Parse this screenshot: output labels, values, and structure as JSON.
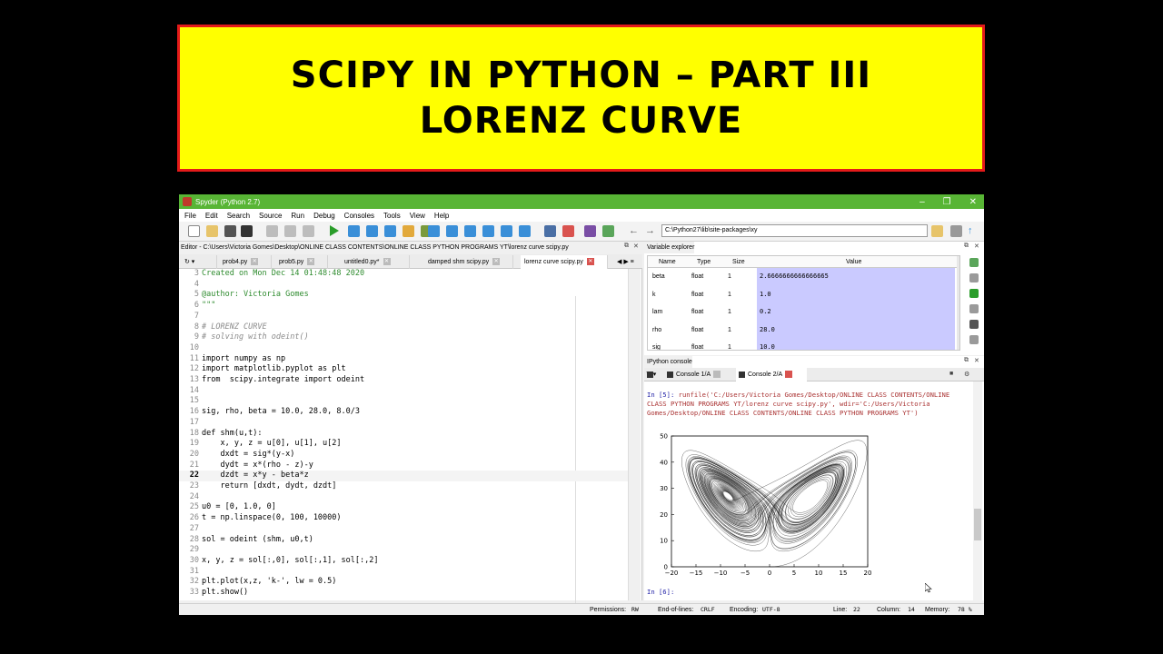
{
  "banner": {
    "line1": "SCIPY IN PYTHON – PART III",
    "line2": "LORENZ CURVE"
  },
  "window": {
    "title": "Spyder (Python 2.7)",
    "controls": [
      "–",
      "❐",
      "✕"
    ]
  },
  "menu": [
    "File",
    "Edit",
    "Search",
    "Source",
    "Run",
    "Debug",
    "Consoles",
    "Tools",
    "View",
    "Help"
  ],
  "toolbar": {
    "path": "C:\\Python27\\lib\\site-packages\\xy"
  },
  "editor": {
    "header": "Editor - C:\\Users\\Victoria Gomes\\Desktop\\ONLINE CLASS CONTENTS\\ONLINE CLASS PYTHON PROGRAMS YT\\lorenz curve scipy.py",
    "tabs": [
      "prob4.py",
      "prob5.py",
      "untitled0.py*",
      "damped shm scipy.py",
      "lorenz curve scipy.py"
    ],
    "lines": [
      {
        "n": "3",
        "t": "Created on Mon Dec 14 01:48:48 2020",
        "k": "str"
      },
      {
        "n": "4",
        "t": "",
        "k": ""
      },
      {
        "n": "5",
        "t": "@author: Victoria Gomes",
        "k": "str"
      },
      {
        "n": "6",
        "t": "\"\"\"",
        "k": "str"
      },
      {
        "n": "7",
        "t": "",
        "k": ""
      },
      {
        "n": "8",
        "t": "# LORENZ CURVE",
        "k": "cm"
      },
      {
        "n": "9",
        "t": "# solving with odeint()",
        "k": "cm"
      },
      {
        "n": "10",
        "t": "",
        "k": ""
      },
      {
        "n": "11",
        "t": "import numpy as np",
        "k": ""
      },
      {
        "n": "12",
        "t": "import matplotlib.pyplot as plt",
        "k": ""
      },
      {
        "n": "13",
        "t": "from  scipy.integrate import odeint",
        "k": ""
      },
      {
        "n": "14",
        "t": "",
        "k": ""
      },
      {
        "n": "15",
        "t": "",
        "k": ""
      },
      {
        "n": "16",
        "t": "sig, rho, beta = 10.0, 28.0, 8.0/3",
        "k": ""
      },
      {
        "n": "17",
        "t": "",
        "k": ""
      },
      {
        "n": "18",
        "t": "def shm(u,t):",
        "k": ""
      },
      {
        "n": "19",
        "t": "    x, y, z = u[0], u[1], u[2]",
        "k": ""
      },
      {
        "n": "20",
        "t": "    dxdt = sig*(y-x)",
        "k": ""
      },
      {
        "n": "21",
        "t": "    dydt = x*(rho - z)-y",
        "k": ""
      },
      {
        "n": "22",
        "t": "    dzdt = x*y - beta*z",
        "k": "cur"
      },
      {
        "n": "23",
        "t": "    return [dxdt, dydt, dzdt]",
        "k": ""
      },
      {
        "n": "24",
        "t": "",
        "k": ""
      },
      {
        "n": "25",
        "t": "u0 = [0, 1.0, 0]",
        "k": ""
      },
      {
        "n": "26",
        "t": "t = np.linspace(0, 100, 10000)",
        "k": ""
      },
      {
        "n": "27",
        "t": "",
        "k": ""
      },
      {
        "n": "28",
        "t": "sol = odeint (shm, u0,t)",
        "k": ""
      },
      {
        "n": "29",
        "t": "",
        "k": ""
      },
      {
        "n": "30",
        "t": "x, y, z = sol[:,0], sol[:,1], sol[:,2]",
        "k": ""
      },
      {
        "n": "31",
        "t": "",
        "k": ""
      },
      {
        "n": "32",
        "t": "plt.plot(x,z, 'k-', lw = 0.5)",
        "k": ""
      },
      {
        "n": "33",
        "t": "plt.show()",
        "k": ""
      }
    ]
  },
  "variable_explorer": {
    "title": "Variable explorer",
    "columns": [
      "Name",
      "Type",
      "Size",
      "Value"
    ],
    "rows": [
      {
        "name": "beta",
        "type": "float",
        "size": "1",
        "value": "2.6666666666666665"
      },
      {
        "name": "k",
        "type": "float",
        "size": "1",
        "value": "1.0"
      },
      {
        "name": "lam",
        "type": "float",
        "size": "1",
        "value": "0.2"
      },
      {
        "name": "rho",
        "type": "float",
        "size": "1",
        "value": "28.0"
      },
      {
        "name": "sig",
        "type": "float",
        "size": "1",
        "value": "10.0"
      }
    ]
  },
  "console": {
    "title": "IPython console",
    "tabs": [
      "Console 1/A",
      "Console 2/A"
    ],
    "prompt_in5": "In [5]:",
    "runfile_line1": " runfile('C:/Users/Victoria Gomes/Desktop/ONLINE CLASS CONTENTS/ONLINE",
    "runfile_line2": "CLASS PYTHON PROGRAMS YT/lorenz curve scipy.py', wdir='C:/Users/Victoria",
    "runfile_line3": "Gomes/Desktop/ONLINE CLASS CONTENTS/ONLINE CLASS PYTHON PROGRAMS YT')",
    "prompt_in6": "In [6]:"
  },
  "chart_data": {
    "type": "line",
    "title": "",
    "xlabel": "",
    "ylabel": "",
    "xlim": [
      -20,
      20
    ],
    "ylim": [
      0,
      50
    ],
    "xticks": [
      "−20",
      "−15",
      "−10",
      "−5",
      "0",
      "5",
      "10",
      "15",
      "20"
    ],
    "yticks": [
      "0",
      "10",
      "20",
      "30",
      "40",
      "50"
    ],
    "series": [
      {
        "color": "#000000",
        "description_note": "Lorenz attractor trajectory (x vs z), sig=10, rho=28, beta=8/3"
      }
    ]
  },
  "statusbar": {
    "permissions_label": "Permissions:",
    "permissions": "RW",
    "eol_label": "End-of-lines:",
    "eol": "CRLF",
    "encoding_label": "Encoding:",
    "encoding": "UTF-8",
    "line_label": "Line:",
    "line": "22",
    "column_label": "Column:",
    "column": "14",
    "memory_label": "Memory:",
    "memory": "78 %"
  }
}
